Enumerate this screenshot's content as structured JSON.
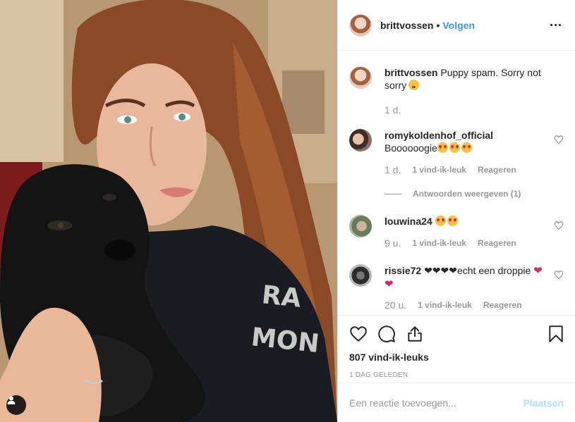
{
  "post": {
    "username": "brittvossen",
    "separator": "•",
    "follow_label": "Volgen",
    "caption": "Puppy spam. Sorry not sorry",
    "caption_time": "1 d."
  },
  "comments": [
    {
      "username": "romykoldenhof_official",
      "text": "Boooooogie",
      "time": "1 d.",
      "likes": "1 vind-ik-leuk",
      "reply": "Reageren",
      "view_replies": "Antwoorden weergeven (1)"
    },
    {
      "username": "louwina24",
      "text": "",
      "time": "9 u.",
      "likes": "1 vind-ik-leuk",
      "reply": "Reageren"
    },
    {
      "username": "rissie72",
      "text": "❤❤❤❤echt een droppie",
      "time": "20 u.",
      "likes": "1 vind-ik-leuk",
      "reply": "Reageren"
    }
  ],
  "actions": {
    "likes_count": "807 vind-ik-leuks",
    "date": "1 DAG GELEDEN"
  },
  "comment_box": {
    "placeholder": "Een reactie toevoegen...",
    "post_label": "Plaatsen"
  },
  "icons": [
    "heart-icon",
    "comment-icon",
    "share-icon",
    "bookmark-icon",
    "more-icon",
    "user-icon"
  ],
  "colors": {
    "link": "#3897f0",
    "post_disabled": "#b2dffc",
    "muted": "#999999",
    "border": "#efefef"
  }
}
